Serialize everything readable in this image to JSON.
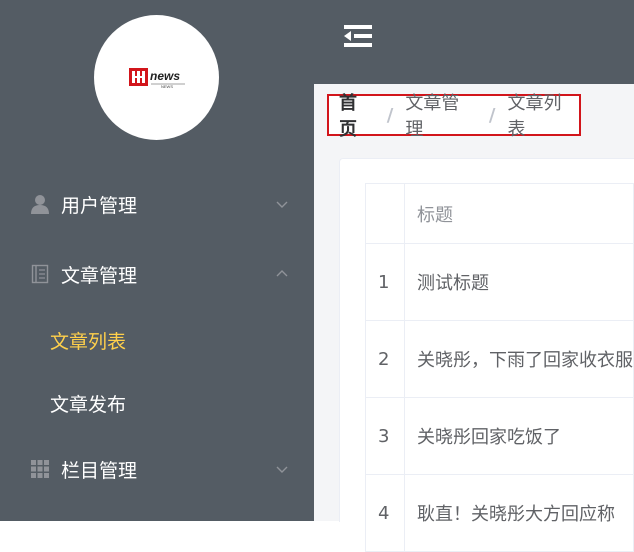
{
  "logo": {
    "text": "news",
    "subtext": "NEWS"
  },
  "sidebar": {
    "items": [
      {
        "label": "用户管理",
        "icon": "user-icon",
        "expanded": false
      },
      {
        "label": "文章管理",
        "icon": "document-icon",
        "expanded": true,
        "children": [
          {
            "label": "文章列表",
            "active": true
          },
          {
            "label": "文章发布",
            "active": false
          }
        ]
      },
      {
        "label": "栏目管理",
        "icon": "grid-icon",
        "expanded": false
      }
    ]
  },
  "breadcrumb": {
    "home": "首页",
    "sep": "/",
    "level1": "文章管理",
    "level2": "文章列表"
  },
  "table": {
    "header": {
      "index": "",
      "title": "标题"
    },
    "rows": [
      {
        "index": "1",
        "title": "测试标题"
      },
      {
        "index": "2",
        "title": "关晓彤，下雨了回家收衣服"
      },
      {
        "index": "3",
        "title": "关晓彤回家吃饭了"
      },
      {
        "index": "4",
        "title": "耿直！关晓彤大方回应称"
      }
    ]
  },
  "colors": {
    "sidebar_bg": "#545c64",
    "active_text": "#ffd04b",
    "highlight_border": "#d2151b"
  }
}
